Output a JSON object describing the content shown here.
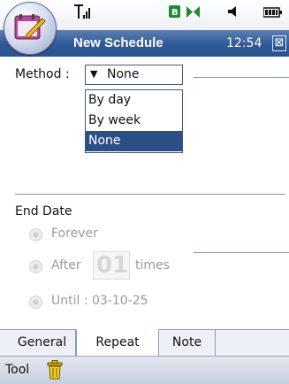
{
  "status": {
    "signal_icon": "signal-strength-icon",
    "indicator_icon": "battery-indicator-icon",
    "speaker_icon": "speaker-icon",
    "battery_icon": "battery-icon"
  },
  "titlebar": {
    "title": "New Schedule",
    "time": "12:54",
    "close_glyph": "⊠"
  },
  "form": {
    "method_label": "Method :",
    "method_value": "None",
    "method_options": [
      "By day",
      "By week",
      "None"
    ],
    "end_date_label": "End Date",
    "forever_label": "Forever",
    "after_label": "After",
    "after_count": "01",
    "times_label": "times",
    "until_label": "Until : 03-10-25"
  },
  "tabs": [
    "General",
    "Repeat",
    "Note"
  ],
  "toolbar": {
    "tool_label": "Tool"
  },
  "colors": {
    "titlebar": "#2f5a97",
    "selection": "#2c4f86",
    "divider": "#6f9bd4"
  }
}
